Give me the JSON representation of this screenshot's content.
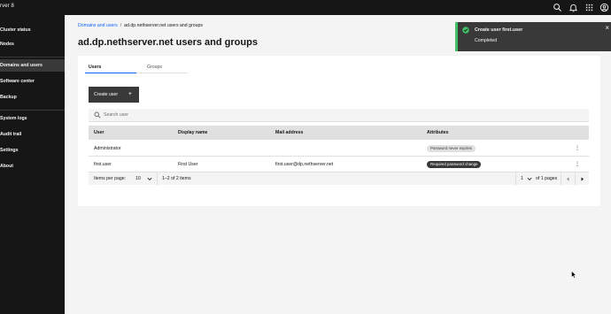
{
  "header": {
    "brand": "rver 8",
    "icons": [
      "search-icon",
      "bell-icon",
      "app-switcher-icon",
      "user-icon"
    ]
  },
  "sidebar": {
    "items": [
      {
        "label": "Cluster status",
        "active": false
      },
      {
        "label": "Nodes",
        "active": false
      },
      {
        "label": "Domains and users",
        "active": true
      },
      {
        "label": "Software center",
        "active": false
      },
      {
        "label": "Backup",
        "active": false
      },
      {
        "label": "System logs",
        "active": false
      },
      {
        "label": "Audit trail",
        "active": false
      },
      {
        "label": "Settings",
        "active": false
      },
      {
        "label": "About",
        "active": false
      }
    ]
  },
  "breadcrumb": {
    "parent": "Domains and users",
    "separator": "/",
    "current": "ad.dp.nethserver.net users and groups"
  },
  "page": {
    "title": "ad.dp.nethserver.net users and groups"
  },
  "tabs": [
    {
      "label": "Users",
      "active": true
    },
    {
      "label": "Groups",
      "active": false
    }
  ],
  "toolbar": {
    "create_label": "Create user",
    "create_icon": "+"
  },
  "search": {
    "placeholder": "Search user",
    "value": ""
  },
  "table": {
    "columns": [
      "User",
      "Display name",
      "Mail address",
      "Attributes"
    ],
    "rows": [
      {
        "user": "Administrator",
        "display_name": "",
        "mail": "",
        "attribute": "Password never expires",
        "attribute_style": "gray"
      },
      {
        "user": "first.user",
        "display_name": "First User",
        "mail": "first.user@dp.nethserver.net",
        "attribute": "Required password change",
        "attribute_style": "dark"
      }
    ]
  },
  "pagination": {
    "items_per_page_label": "Items per page:",
    "items_per_page": "10",
    "range": "1–2 of 2 items",
    "page": "1",
    "of_pages": "of 1 pages"
  },
  "toast": {
    "title": "Create user first.user",
    "subtitle": "Completed",
    "status_color": "#42be65"
  },
  "colors": {
    "accent": "#0f62fe",
    "sidebar_bg": "#161616",
    "active_item_bg": "#393939",
    "success": "#42be65"
  }
}
